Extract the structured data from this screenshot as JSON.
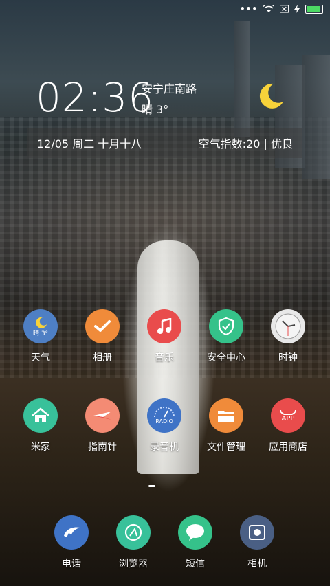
{
  "status": {
    "dots": "•••",
    "wifi_icon": "wifi-icon",
    "sim_icon": "sim-x-icon",
    "charging_icon": "bolt-icon",
    "battery_icon": "battery-icon",
    "battery_level": 0.8
  },
  "widget": {
    "time": "02:36",
    "location": "安宁庄南路",
    "weather": "晴 3°",
    "moon_icon": "crescent-moon-icon",
    "date": "12/05 周二 十月十八",
    "air_quality": "空气指数:20 | 优良"
  },
  "apps_row1": [
    {
      "label": "天气",
      "icon": "weather-icon",
      "color": "#4e7fc4",
      "badge": "晴 3°"
    },
    {
      "label": "相册",
      "icon": "gallery-icon",
      "color": "#f08b3a"
    },
    {
      "label": "音乐",
      "icon": "music-icon",
      "color": "#e94c4c"
    },
    {
      "label": "安全中心",
      "icon": "shield-icon",
      "color": "#35c28a"
    },
    {
      "label": "时钟",
      "icon": "clock-icon",
      "color": "#e8e8e8"
    }
  ],
  "apps_row2": [
    {
      "label": "米家",
      "icon": "home-icon",
      "color": "#38c19a"
    },
    {
      "label": "指南针",
      "icon": "compass-icon",
      "color": "#f48b74"
    },
    {
      "label": "录音机",
      "icon": "radio-icon",
      "color": "#3f73c6",
      "badge": "RADIO"
    },
    {
      "label": "文件管理",
      "icon": "folder-icon",
      "color": "#f08b3a"
    },
    {
      "label": "应用商店",
      "icon": "app-store-icon",
      "color": "#e94c4c",
      "badge": "APP"
    }
  ],
  "dock": [
    {
      "label": "电话",
      "icon": "phone-icon",
      "color": "#3f73c6"
    },
    {
      "label": "浏览器",
      "icon": "browser-icon",
      "color": "#38c19a"
    },
    {
      "label": "短信",
      "icon": "message-icon",
      "color": "#35c28a"
    },
    {
      "label": "相机",
      "icon": "camera-icon",
      "color": "#4a5f84"
    }
  ]
}
